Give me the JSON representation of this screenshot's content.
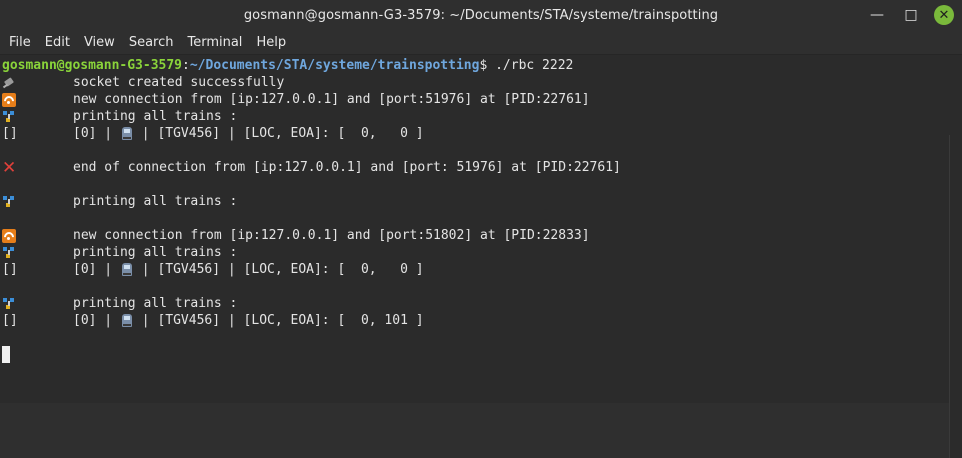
{
  "window": {
    "title": "gosmann@gosmann-G3-3579: ~/Documents/STA/systeme/trainspotting",
    "minimize_glyph": "—",
    "maximize_glyph": "□",
    "close_glyph": "✕"
  },
  "menu": [
    "File",
    "Edit",
    "View",
    "Search",
    "Terminal",
    "Help"
  ],
  "prompt": {
    "user": "gosmann@gosmann-G3-3579",
    "sep": ":",
    "path": "~/Documents/STA/systeme/trainspotting",
    "symbol": "$ ",
    "command": "./rbc 2222"
  },
  "lines": [
    {
      "icon": "socket-icon",
      "text": "socket created successfully"
    },
    {
      "icon": "wifi-icon",
      "text": "new connection from [ip:127.0.0.1] and [port:51976] at [PID:22761]"
    },
    {
      "icon": "network-icon",
      "text": "printing all trains :"
    },
    {
      "prefix": "[]",
      "text_a": "[0] | ",
      "icon": "train-icon",
      "text_b": " | [TGV456] | [LOC, EOA]: [  0,   0 ]"
    },
    {
      "blank": true
    },
    {
      "icon": "cross-icon",
      "glyph": "✕",
      "text": "end of connection from [ip:127.0.0.1] and [port: 51976] at [PID:22761]"
    },
    {
      "blank": true
    },
    {
      "icon": "network-icon",
      "text": "printing all trains :"
    },
    {
      "blank": true
    },
    {
      "icon": "wifi-icon",
      "text": "new connection from [ip:127.0.0.1] and [port:51802] at [PID:22833]"
    },
    {
      "icon": "network-icon",
      "text": "printing all trains :"
    },
    {
      "prefix": "[]",
      "text_a": "[0] | ",
      "icon": "train-icon",
      "text_b": " | [TGV456] | [LOC, EOA]: [  0,   0 ]"
    },
    {
      "blank": true
    },
    {
      "icon": "network-icon",
      "text": "printing all trains :"
    },
    {
      "prefix": "[]",
      "text_a": "[0] | ",
      "icon": "train-icon",
      "text_b": " | [TGV456] | [LOC, EOA]: [  0, 101 ]"
    }
  ],
  "colors": {
    "prompt_user": "#8ad43a",
    "prompt_path": "#6fa7de",
    "close_button": "#7ab93b",
    "error_icon": "#e0403a"
  }
}
